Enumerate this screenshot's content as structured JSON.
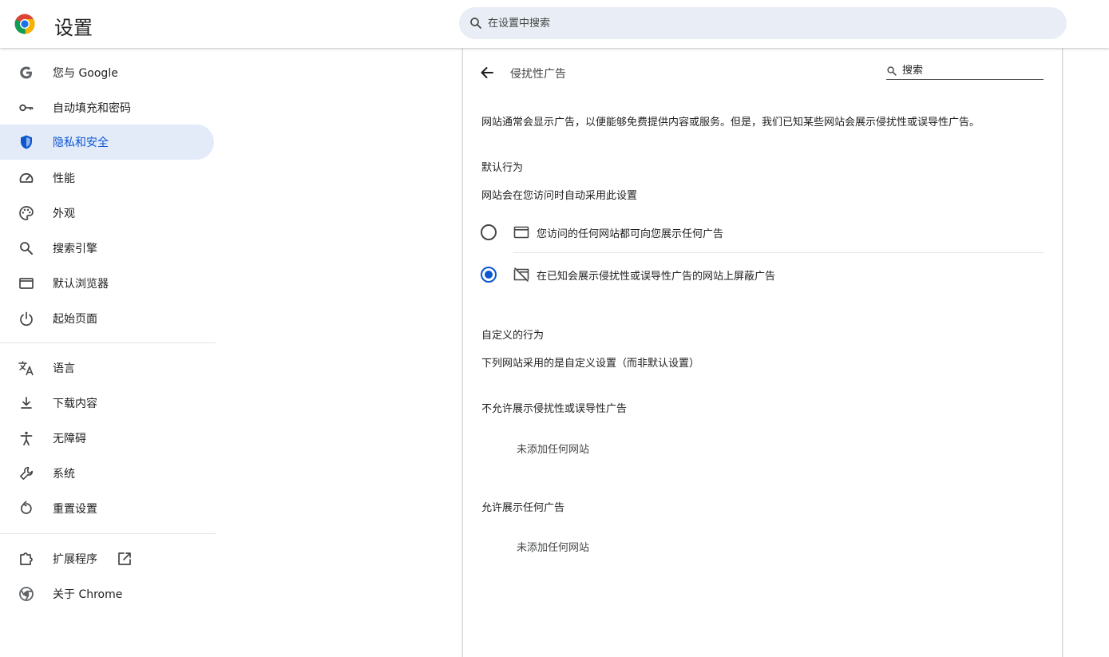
{
  "header": {
    "title": "设置",
    "search_placeholder": "在设置中搜索"
  },
  "sidebar": {
    "items": [
      {
        "label": "您与 Google",
        "icon": "google-g-icon"
      },
      {
        "label": "自动填充和密码",
        "icon": "key-icon"
      },
      {
        "label": "隐私和安全",
        "icon": "shield-icon",
        "active": true
      },
      {
        "label": "性能",
        "icon": "speedometer-icon"
      },
      {
        "label": "外观",
        "icon": "palette-icon"
      },
      {
        "label": "搜索引擎",
        "icon": "search-icon"
      },
      {
        "label": "默认浏览器",
        "icon": "browser-window-icon"
      },
      {
        "label": "起始页面",
        "icon": "power-icon"
      },
      {
        "label": "语言",
        "icon": "translate-icon"
      },
      {
        "label": "下载内容",
        "icon": "download-icon"
      },
      {
        "label": "无障碍",
        "icon": "accessibility-icon"
      },
      {
        "label": "系统",
        "icon": "wrench-icon"
      },
      {
        "label": "重置设置",
        "icon": "reset-icon"
      },
      {
        "label": "扩展程序",
        "icon": "puzzle-icon"
      },
      {
        "label": "关于 Chrome",
        "icon": "chrome-icon"
      }
    ]
  },
  "page": {
    "title": "侵扰性广告",
    "search_placeholder": "搜索",
    "description": "网站通常会显示广告，以便能够免费提供内容或服务。但是，我们已知某些网站会展示侵扰性或误导性广告。",
    "default_behavior": {
      "heading": "默认行为",
      "subheading": "网站会在您访问时自动采用此设置",
      "options": [
        {
          "label": "您访问的任何网站都可向您展示任何广告",
          "icon": "browser-window-icon",
          "checked": false
        },
        {
          "label": "在已知会展示侵扰性或误导性广告的网站上屏蔽广告",
          "icon": "ads-blocked-icon",
          "checked": true
        }
      ]
    },
    "custom_behavior": {
      "heading": "自定义的行为",
      "subheading": "下列网站采用的是自定义设置（而非默认设置）"
    },
    "lists": [
      {
        "heading": "不允许展示侵扰性或误导性广告",
        "empty_text": "未添加任何网站"
      },
      {
        "heading": "允许展示任何广告",
        "empty_text": "未添加任何网站"
      }
    ]
  },
  "colors": {
    "accent": "#0b57d0",
    "active_bg": "#e3eaf8",
    "search_bg": "#e9eef6"
  }
}
